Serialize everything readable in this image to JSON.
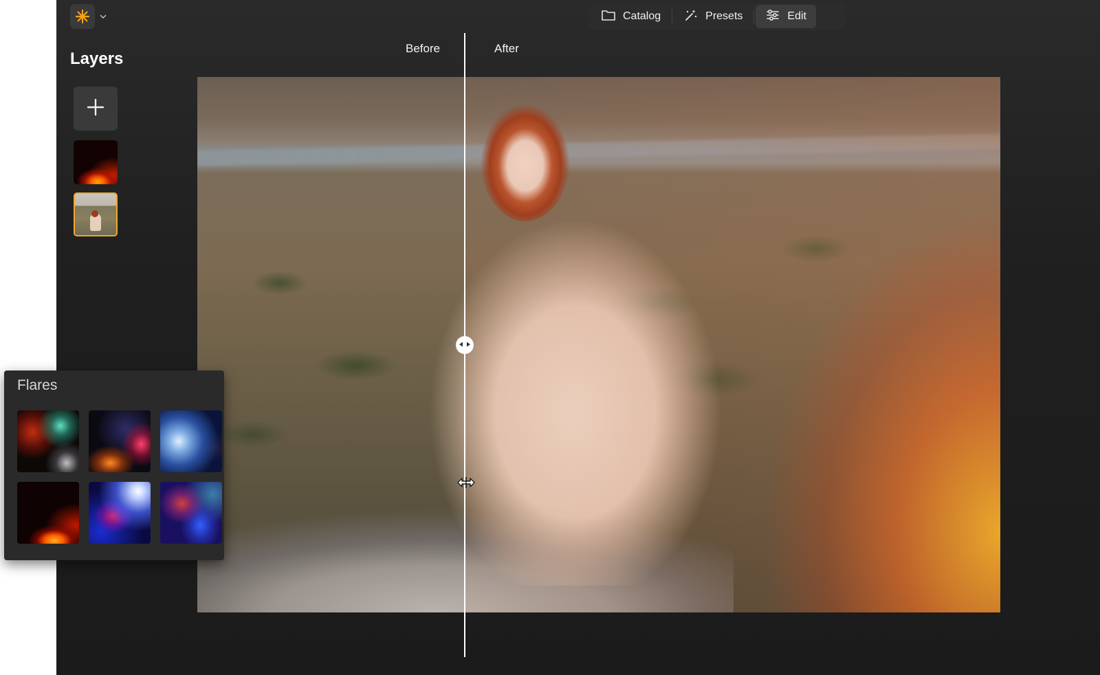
{
  "top_bar": {
    "modes": [
      {
        "label": "Catalog",
        "icon": "folder-icon",
        "active": false
      },
      {
        "label": "Presets",
        "icon": "magic-wand-icon",
        "active": false
      },
      {
        "label": "Edit",
        "icon": "sliders-icon",
        "active": true
      }
    ]
  },
  "layers": {
    "title": "Layers"
  },
  "compare": {
    "before_label": "Before",
    "after_label": "After"
  },
  "flares_panel": {
    "title": "Flares",
    "count": 6
  },
  "colors": {
    "accent": "#f0a92a",
    "app_background": "#1f1f1f",
    "panel_background": "#2a2a2a"
  }
}
